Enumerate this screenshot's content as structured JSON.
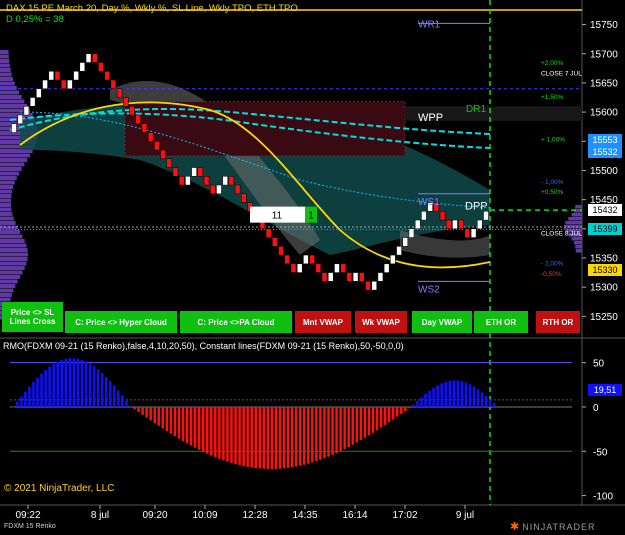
{
  "header": {
    "title": "DAX 15 PE March 20, Day %, Wkly %, SL Line, Wkly TPO, ETH TPO",
    "subtitle": "D 0,25% = 38"
  },
  "price_axis": {
    "labels": [
      "15750",
      "15700",
      "15650",
      "15600",
      "15550",
      "15500",
      "15450",
      "15400",
      "15350",
      "15300",
      "15250"
    ],
    "values": [
      15750,
      15700,
      15650,
      15600,
      15550,
      15500,
      15450,
      15400,
      15350,
      15300,
      15250
    ],
    "range": [
      15230,
      15775
    ]
  },
  "price_tags": [
    {
      "text": "15553",
      "value": 15553,
      "bg": "#1e90ff",
      "fg": "#ffffff"
    },
    {
      "text": "15532",
      "value": 15532,
      "bg": "#1e90ff",
      "fg": "#ffffff"
    },
    {
      "text": "15432",
      "value": 15432,
      "bg": "#ffffff",
      "fg": "#000000"
    },
    {
      "text": "15399",
      "value": 15399,
      "bg": "#00d0d0",
      "fg": "#000000"
    },
    {
      "text": "15330",
      "value": 15330,
      "bg": "#ffd700",
      "fg": "#000000"
    }
  ],
  "level_labels": [
    {
      "text": "WR1",
      "value": 15752,
      "color": "#8080ff"
    },
    {
      "text": "WPP",
      "value": 15592,
      "color": "#ffffff"
    },
    {
      "text": "WS1",
      "value": 15448,
      "color": "#8080ff"
    },
    {
      "text": "DPP",
      "value": 15440,
      "color": "#ffffff"
    },
    {
      "text": "WS2",
      "value": 15298,
      "color": "#8080ff"
    },
    {
      "text": "DR1",
      "value": 15607,
      "color": "#10c010"
    }
  ],
  "pct_labels": [
    {
      "text": "+2,00%",
      "value": 15686,
      "color": "#10e010"
    },
    {
      "text": "CLOSE 7 JUL",
      "value": 15668,
      "color": "#ffffff"
    },
    {
      "text": "+1,50%",
      "value": 15628,
      "color": "#10e010"
    },
    {
      "text": "+ 1,00%",
      "value": 15555,
      "color": "#10e010"
    },
    {
      "text": "- 1,00%",
      "value": 15482,
      "color": "#4060ff"
    },
    {
      "text": "+0,50%",
      "value": 15465,
      "color": "#10e010"
    },
    {
      "text": "CLOSE 8 JUL",
      "value": 15394,
      "color": "#ffffff"
    },
    {
      "text": "- 2,00%",
      "value": 15342,
      "color": "#4060ff"
    },
    {
      "text": "-0,50%",
      "value": 15324,
      "color": "#ff3030"
    }
  ],
  "box_counter": {
    "left": "11",
    "right": "1"
  },
  "buttons": [
    {
      "label": "Price <> SL Lines Cross",
      "kind": "green"
    },
    {
      "label": "C: Price <> Hyper Cloud",
      "kind": "green"
    },
    {
      "label": "C: Price <>PA Cloud",
      "kind": "green"
    },
    {
      "label": "Mnt VWAP",
      "kind": "red"
    },
    {
      "label": "Wk VWAP",
      "kind": "red"
    },
    {
      "label": "Day VWAP",
      "kind": "green"
    },
    {
      "label": "ETH OR",
      "kind": "green"
    },
    {
      "label": "RTH OR",
      "kind": "red"
    }
  ],
  "indicator": {
    "title": "RMO(FDXM 09-21 (15 Renko),false,4,10,20,50), Constant lines(FDXM 09-21 (15 Renko),50,-50,0,0)",
    "axis_labels": [
      "50",
      "0",
      "-50",
      "-100"
    ],
    "axis_values": [
      50,
      0,
      -50,
      -100
    ],
    "range": [
      -105,
      62
    ],
    "value_tag": "19,51",
    "value": 19.51
  },
  "copyright": "© 2021 NinjaTrader, LLC",
  "time_axis": {
    "labels": [
      "09:22",
      "8 jul",
      "09:20",
      "10:09",
      "12:28",
      "14:35",
      "16:14",
      "17:02",
      "9 jul"
    ]
  },
  "footer_left": "FDXM 15 Renko",
  "brand": "NINJATRADER",
  "colors": {
    "bull": "#ffffff",
    "bear": "#ff1010",
    "osc_pos": "#1010ff",
    "osc_neg": "#ff1010",
    "gridline": "#333333",
    "gold": "#ffd700",
    "green_dash": "#10e010"
  }
}
